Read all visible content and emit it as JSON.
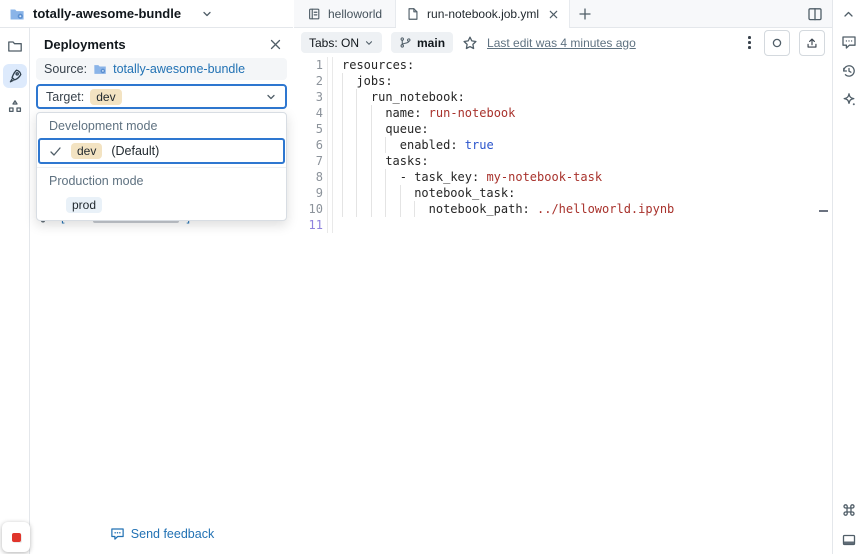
{
  "topbar": {
    "bundle_name": "totally-awesome-bundle"
  },
  "panel": {
    "title": "Deployments",
    "source": {
      "label": "Source:",
      "link": "totally-awesome-bundle"
    },
    "target": {
      "label": "Target:",
      "value": "dev"
    },
    "dropdown": {
      "group1_label": "Development mode",
      "option1": {
        "badge": "dev",
        "suffix": "(Default)"
      },
      "group2_label": "Production mode",
      "option2": {
        "badge": "prod"
      }
    },
    "job_link": {
      "prefix": "[dev",
      "suffix": "] run-notebook"
    },
    "feedback_label": "Send feedback"
  },
  "editor": {
    "tabs": {
      "tab1": "helloworld",
      "tab2": "run-notebook.job.yml"
    },
    "toolbar": {
      "tabs_toggle": "Tabs: ON",
      "branch": "main",
      "last_edit": "Last edit was 4 minutes ago"
    },
    "code": {
      "language": "yaml",
      "active_line": 11,
      "lines": [
        {
          "n": 1,
          "indent": 0,
          "segments": [
            {
              "c": "k",
              "t": "resources:"
            }
          ]
        },
        {
          "n": 2,
          "indent": 2,
          "segments": [
            {
              "c": "k",
              "t": "jobs:"
            }
          ]
        },
        {
          "n": 3,
          "indent": 4,
          "segments": [
            {
              "c": "k",
              "t": "run_notebook:"
            }
          ]
        },
        {
          "n": 4,
          "indent": 6,
          "segments": [
            {
              "c": "k",
              "t": "name: "
            },
            {
              "c": "s",
              "t": "run-notebook"
            }
          ]
        },
        {
          "n": 5,
          "indent": 6,
          "segments": [
            {
              "c": "k",
              "t": "queue:"
            }
          ]
        },
        {
          "n": 6,
          "indent": 8,
          "segments": [
            {
              "c": "k",
              "t": "enabled: "
            },
            {
              "c": "b",
              "t": "true"
            }
          ]
        },
        {
          "n": 7,
          "indent": 6,
          "segments": [
            {
              "c": "k",
              "t": "tasks:"
            }
          ]
        },
        {
          "n": 8,
          "indent": 8,
          "segments": [
            {
              "c": "k",
              "t": "- task_key: "
            },
            {
              "c": "s",
              "t": "my-notebook-task"
            }
          ]
        },
        {
          "n": 9,
          "indent": 10,
          "segments": [
            {
              "c": "k",
              "t": "notebook_task:"
            }
          ]
        },
        {
          "n": 10,
          "indent": 12,
          "segments": [
            {
              "c": "k",
              "t": "notebook_path: "
            },
            {
              "c": "s",
              "t": "../helloworld.ipynb"
            }
          ]
        },
        {
          "n": 11,
          "indent": 0,
          "segments": []
        }
      ]
    }
  },
  "colors": {
    "accent_blue": "#2272b4",
    "selection_border": "#2e77d0",
    "dev_badge_bg": "#f3e3c2",
    "prod_badge_bg": "#e9f1f8",
    "string_token": "#a8322c",
    "bool_token": "#2b55cc",
    "active_line_number": "#8f83dd"
  }
}
